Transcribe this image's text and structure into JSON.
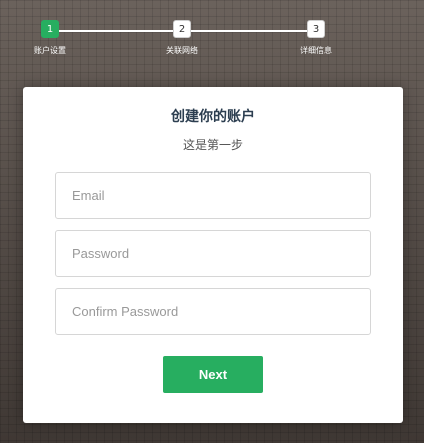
{
  "progress": {
    "steps": [
      {
        "number": "1",
        "label": "账户设置",
        "active": true
      },
      {
        "number": "2",
        "label": "关联网络",
        "active": false
      },
      {
        "number": "3",
        "label": "详细信息",
        "active": false
      }
    ]
  },
  "form": {
    "title": "创建你的账户",
    "subtitle": "这是第一步",
    "email_placeholder": "Email",
    "password_placeholder": "Password",
    "confirm_placeholder": "Confirm Password",
    "next_label": "Next"
  },
  "colors": {
    "accent": "#27ae60",
    "title": "#2c3e50",
    "background": "#4d4540"
  }
}
